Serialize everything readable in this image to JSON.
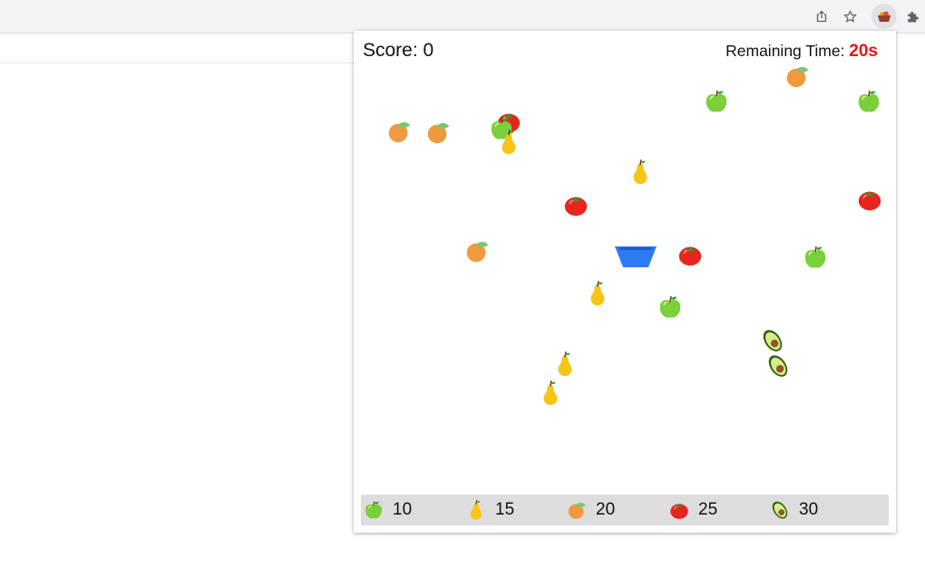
{
  "browser": {
    "toolbar_icons": [
      "share-icon",
      "star-icon",
      "fruit-extension-icon",
      "puzzle-icon"
    ]
  },
  "game": {
    "score_label": "Score: ",
    "score": "0",
    "time_label": "Remaining Time: ",
    "time_value": "20s",
    "colors": {
      "timer": "#ee1111",
      "basket": "#2d7cf6",
      "legend_bg": "#dddddd"
    },
    "basket_icon": "basket-icon",
    "fruits": [
      {
        "kind": "orange"
      },
      {
        "kind": "orange"
      },
      {
        "kind": "tomato"
      },
      {
        "kind": "apple"
      },
      {
        "kind": "pear"
      },
      {
        "kind": "apple"
      },
      {
        "kind": "orange"
      },
      {
        "kind": "apple"
      },
      {
        "kind": "pear"
      },
      {
        "kind": "tomato"
      },
      {
        "kind": "tomato"
      },
      {
        "kind": "orange"
      },
      {
        "kind": "tomato"
      },
      {
        "kind": "apple"
      },
      {
        "kind": "pear"
      },
      {
        "kind": "apple"
      },
      {
        "kind": "avocado"
      },
      {
        "kind": "pear"
      },
      {
        "kind": "avocado"
      },
      {
        "kind": "pear"
      }
    ],
    "legend": [
      {
        "fruit": "apple",
        "points": "10"
      },
      {
        "fruit": "pear",
        "points": "15"
      },
      {
        "fruit": "orange",
        "points": "20"
      },
      {
        "fruit": "tomato",
        "points": "25"
      },
      {
        "fruit": "avocado",
        "points": "30"
      }
    ]
  }
}
